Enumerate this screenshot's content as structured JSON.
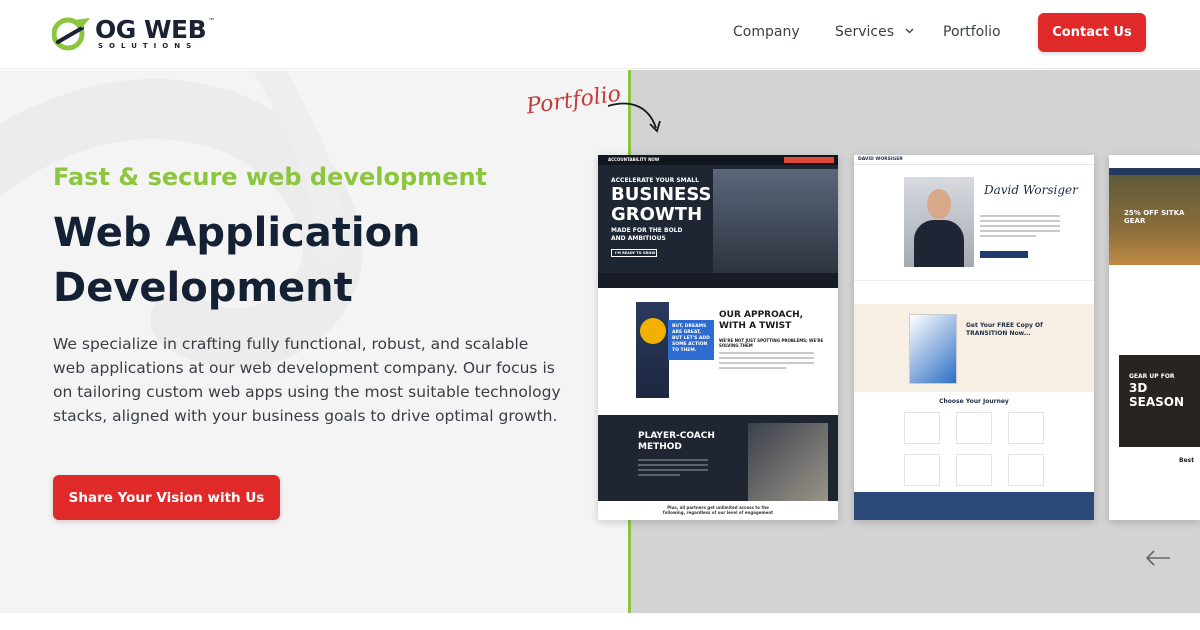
{
  "brand": {
    "name": "OG WEB",
    "sub": "SOLUTIONS",
    "tm": "™",
    "colors": {
      "green": "#8cc63f",
      "navy": "#142033",
      "red": "#e02a2a"
    }
  },
  "nav": {
    "items": [
      "Company",
      "Services",
      "Portfolio"
    ],
    "contact_label": "Contact Us"
  },
  "hero": {
    "tagline": "Fast & secure web development",
    "headline": "Web Application Development",
    "description": "We specialize in crafting fully functional, robust, and scalable web applications at our web development company. Our focus is on tailoring custom web apps using the most suitable technology stacks, aligned with your business goals to drive optimal growth.",
    "cta_label": "Share Your Vision with Us"
  },
  "portfolio": {
    "label": "Portfolio",
    "card1": {
      "nav": "ACCOUNTABILITY NOW",
      "hero_a": "ACCELERATE YOUR SMALL",
      "hero_b": "BUSINESS GROWTH",
      "hero_c": "MADE FOR THE BOLD AND AMBITIOUS",
      "hero_btn": "I'M READY TO GROW",
      "blue_note": "BUT, DREAMS ARE GREAT, BUT LET'S ADD SOME ACTION TO THEM.",
      "approach": "OUR APPROACH, WITH A TWIST",
      "approach_sub": "WE'RE NOT JUST SPOTTING PROBLEMS; WE'RE SOLVING THEM",
      "player": "PLAYER-COACH METHOD",
      "foot": "Plus, all partners get unlimited access to the following, regardless of our level of engagement"
    },
    "card2": {
      "nav": "DAVID WORSIGER",
      "script": "David Worsiger",
      "book": "Get Your FREE Copy Of TRANSITION Now...",
      "journey": "Choose Your Journey"
    },
    "card3": {
      "hero": "25% OFF SITKA GEAR",
      "gear": "GEAR UP FOR",
      "season": "3D SEASON",
      "best": "Best"
    }
  },
  "icons": {
    "logo": "og-logo-swoosh-icon",
    "chevron": "chevron-down-icon",
    "arrow": "curved-arrow-icon",
    "back": "arrow-left-icon"
  }
}
